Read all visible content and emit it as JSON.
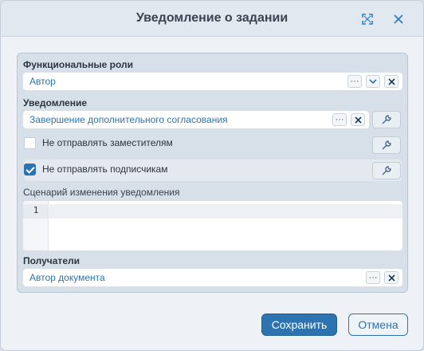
{
  "dialog": {
    "title": "Уведомление о задании",
    "expand_icon": "expand-icon",
    "close_icon": "close-icon"
  },
  "roles": {
    "label": "Функциональные роли",
    "value": "Автор",
    "more_glyph": "···",
    "icons": [
      "more-icon",
      "chevron-down-icon",
      "clear-icon"
    ]
  },
  "notification": {
    "label": "Уведомление",
    "value": "Завершение дополнительного согласования",
    "more_glyph": "···",
    "icons": [
      "more-icon",
      "clear-icon",
      "wrench-icon"
    ]
  },
  "options": [
    {
      "label": "Не отправлять заместителям",
      "checked": false
    },
    {
      "label": "Не отправлять подписчикам",
      "checked": true
    }
  ],
  "script": {
    "label": "Сценарий изменения уведомления",
    "line_number": "1",
    "content": ""
  },
  "recipients": {
    "label": "Получатели",
    "value": "Автор документа",
    "more_glyph": "···"
  },
  "footer": {
    "save_label": "Сохранить",
    "cancel_label": "Отмена"
  },
  "colors": {
    "accent": "#2d73b0",
    "link_text": "#2f73ad",
    "panel_bg": "#d7e0e9"
  }
}
